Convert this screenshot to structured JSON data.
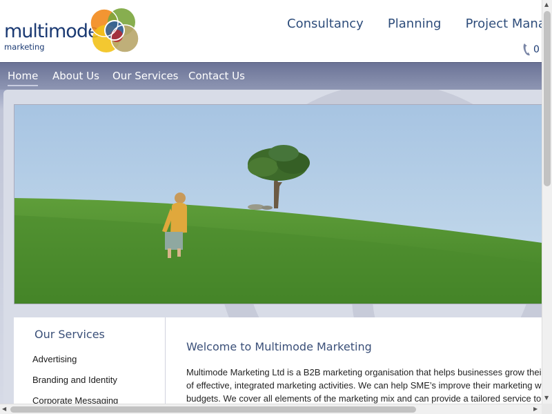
{
  "header": {
    "logo_word": "multimode",
    "logo_sub": "marketing",
    "top_links": [
      "Consultancy",
      "Planning",
      "Project Manage"
    ],
    "phone_text": "0"
  },
  "nav": {
    "items": [
      "Home",
      "About Us",
      "Our Services",
      "Contact Us"
    ],
    "active": "Home"
  },
  "sidebar": {
    "title": "Our Services",
    "items": [
      "Advertising",
      "Branding and Identity",
      "Corporate Messaging"
    ]
  },
  "main": {
    "heading": "Welcome to Multimode Marketing",
    "lines": [
      "Multimode Marketing Ltd is a B2B marketing organisation that helps businesses grow thei",
      "of effective, integrated marketing activities. We can help SME’s improve their marketing w",
      "budgets. We cover all elements of the marketing mix and can provide a tailored service to"
    ]
  },
  "colors": {
    "brand_navy": "#1b3a73",
    "nav_bar": "#7b83a3",
    "logo_orange": "#f28a1c",
    "logo_green": "#7aa53c",
    "logo_blue": "#2a5aa0",
    "logo_red": "#b5282e",
    "logo_yellow": "#f2c219",
    "logo_olive": "#b8a66a"
  },
  "icons": {
    "phone": "phone-icon",
    "logo": "venn-logo-icon"
  }
}
